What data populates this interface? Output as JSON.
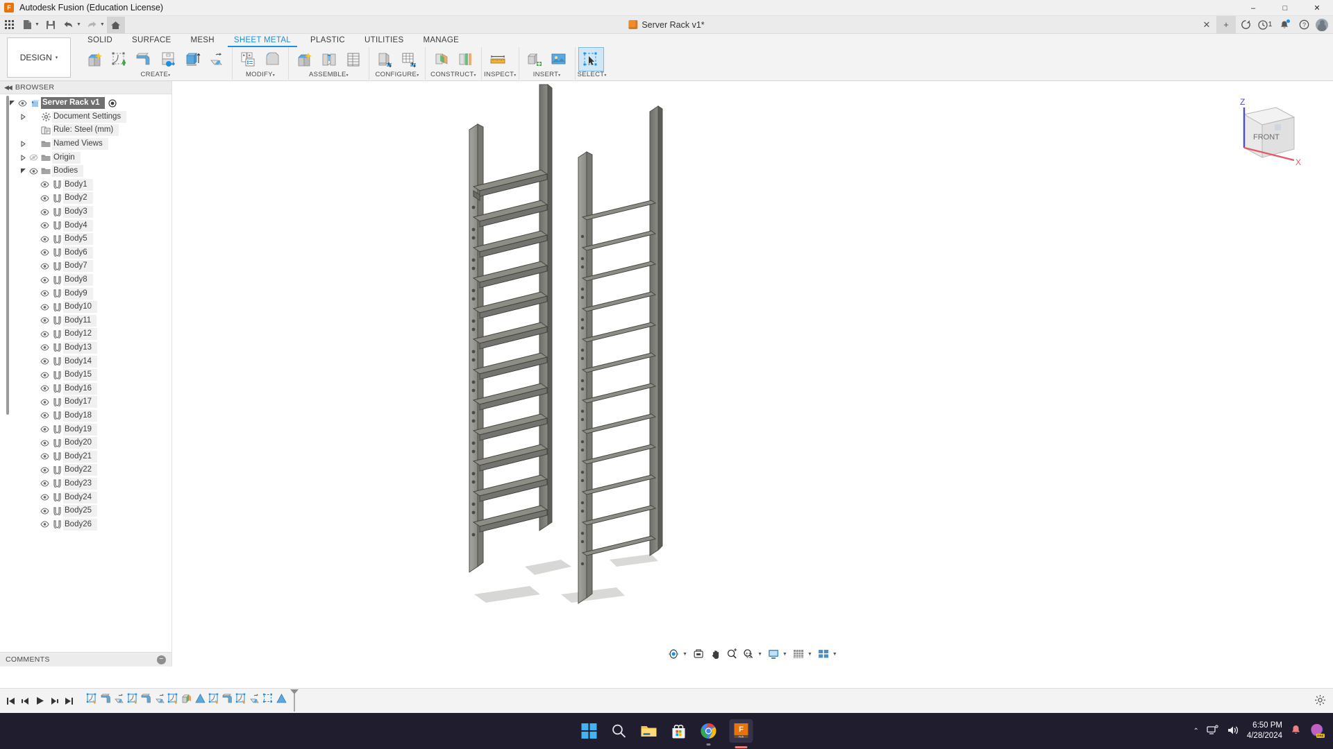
{
  "window": {
    "app_title": "Autodesk Fusion (Education License)",
    "app_icon": "fusion-logo-icon",
    "minimize": "–",
    "maximize": "□",
    "close": "✕"
  },
  "quick_access": {
    "grid_menu": "app-grid-icon",
    "new_file": "new-file-icon",
    "save": "save-icon",
    "undo": "undo-icon",
    "redo": "redo-icon",
    "home": "home-icon"
  },
  "document_tab": {
    "title": "Server Rack v1*",
    "icon": "orange-cube-icon",
    "close": "✕",
    "add_tab": "+"
  },
  "tab_right_icons": {
    "refresh": "refresh-icon",
    "jobs": "job-status-icon",
    "jobs_count": "1",
    "notifications": "bell-icon",
    "help": "help-icon",
    "account": "user-avatar-icon"
  },
  "workspace": {
    "label": "DESIGN",
    "caret": "▾"
  },
  "ribbon": {
    "tabs": [
      {
        "label": "SOLID",
        "active": false
      },
      {
        "label": "SURFACE",
        "active": false
      },
      {
        "label": "MESH",
        "active": false
      },
      {
        "label": "SHEET METAL",
        "active": true
      },
      {
        "label": "PLASTIC",
        "active": false
      },
      {
        "label": "UTILITIES",
        "active": false
      },
      {
        "label": "MANAGE",
        "active": false
      }
    ],
    "panels": [
      {
        "label": "CREATE",
        "caret": "▾",
        "tools": [
          "new-component-icon",
          "create-sketch-icon",
          "flange-icon",
          "contour-flange-icon",
          "extrude-icon",
          "unfold-icon"
        ]
      },
      {
        "label": "MODIFY",
        "caret": "▾",
        "tools": [
          "sheet-metal-rules-icon",
          "bend-icon"
        ]
      },
      {
        "label": "ASSEMBLE",
        "caret": "▾",
        "tools": [
          "new-component-assemble-icon",
          "joint-icon",
          "joint-origin-icon"
        ]
      },
      {
        "label": "CONFIGURE",
        "caret": "▾",
        "tools": [
          "configure-design-icon",
          "configuration-table-icon"
        ]
      },
      {
        "label": "CONSTRUCT",
        "caret": "▾",
        "tools": [
          "offset-plane-icon",
          "plane-at-angle-icon"
        ]
      },
      {
        "label": "INSPECT",
        "caret": "▾",
        "tools": [
          "measure-icon"
        ]
      },
      {
        "label": "INSERT",
        "caret": "▾",
        "tools": [
          "insert-derive-icon",
          "insert-canvas-icon"
        ]
      },
      {
        "label": "SELECT",
        "caret": "▾",
        "tools": [
          "select-cursor-icon"
        ]
      }
    ]
  },
  "browser": {
    "header": "BROWSER",
    "collapse_icon": "collapse-left-icon",
    "tree": [
      {
        "label": "Server Rack v1",
        "indent": 0,
        "arrow": "expanded",
        "eye": "visible",
        "icon": "component-icon",
        "selected": true,
        "trailing": "radio-icon"
      },
      {
        "label": "Document Settings",
        "indent": 1,
        "arrow": "collapsed",
        "eye": "none",
        "icon": "gear-icon",
        "selected": false
      },
      {
        "label": "Rule: Steel (mm)",
        "indent": 1,
        "arrow": "none",
        "eye": "none",
        "icon": "rule-icon",
        "selected": false
      },
      {
        "label": "Named Views",
        "indent": 1,
        "arrow": "collapsed",
        "eye": "none",
        "icon": "folder-icon",
        "selected": false
      },
      {
        "label": "Origin",
        "indent": 1,
        "arrow": "collapsed",
        "eye": "hidden",
        "icon": "folder-icon",
        "selected": false
      },
      {
        "label": "Bodies",
        "indent": 1,
        "arrow": "expanded",
        "eye": "visible",
        "icon": "folder-icon",
        "selected": false
      },
      {
        "label": "Body1",
        "indent": 2,
        "arrow": "none",
        "eye": "visible",
        "icon": "body-icon",
        "selected": false
      },
      {
        "label": "Body2",
        "indent": 2,
        "arrow": "none",
        "eye": "visible",
        "icon": "body-icon",
        "selected": false
      },
      {
        "label": "Body3",
        "indent": 2,
        "arrow": "none",
        "eye": "visible",
        "icon": "body-icon",
        "selected": false
      },
      {
        "label": "Body4",
        "indent": 2,
        "arrow": "none",
        "eye": "visible",
        "icon": "body-icon",
        "selected": false
      },
      {
        "label": "Body5",
        "indent": 2,
        "arrow": "none",
        "eye": "visible",
        "icon": "body-icon",
        "selected": false
      },
      {
        "label": "Body6",
        "indent": 2,
        "arrow": "none",
        "eye": "visible",
        "icon": "body-icon",
        "selected": false
      },
      {
        "label": "Body7",
        "indent": 2,
        "arrow": "none",
        "eye": "visible",
        "icon": "body-icon",
        "selected": false
      },
      {
        "label": "Body8",
        "indent": 2,
        "arrow": "none",
        "eye": "visible",
        "icon": "body-icon",
        "selected": false
      },
      {
        "label": "Body9",
        "indent": 2,
        "arrow": "none",
        "eye": "visible",
        "icon": "body-icon",
        "selected": false
      },
      {
        "label": "Body10",
        "indent": 2,
        "arrow": "none",
        "eye": "visible",
        "icon": "body-icon",
        "selected": false
      },
      {
        "label": "Body11",
        "indent": 2,
        "arrow": "none",
        "eye": "visible",
        "icon": "body-icon",
        "selected": false
      },
      {
        "label": "Body12",
        "indent": 2,
        "arrow": "none",
        "eye": "visible",
        "icon": "body-icon",
        "selected": false
      },
      {
        "label": "Body13",
        "indent": 2,
        "arrow": "none",
        "eye": "visible",
        "icon": "body-icon",
        "selected": false
      },
      {
        "label": "Body14",
        "indent": 2,
        "arrow": "none",
        "eye": "visible",
        "icon": "body-icon",
        "selected": false
      },
      {
        "label": "Body15",
        "indent": 2,
        "arrow": "none",
        "eye": "visible",
        "icon": "body-icon",
        "selected": false
      },
      {
        "label": "Body16",
        "indent": 2,
        "arrow": "none",
        "eye": "visible",
        "icon": "body-icon",
        "selected": false
      },
      {
        "label": "Body17",
        "indent": 2,
        "arrow": "none",
        "eye": "visible",
        "icon": "body-icon",
        "selected": false
      },
      {
        "label": "Body18",
        "indent": 2,
        "arrow": "none",
        "eye": "visible",
        "icon": "body-icon",
        "selected": false
      },
      {
        "label": "Body19",
        "indent": 2,
        "arrow": "none",
        "eye": "visible",
        "icon": "body-icon",
        "selected": false
      },
      {
        "label": "Body20",
        "indent": 2,
        "arrow": "none",
        "eye": "visible",
        "icon": "body-icon",
        "selected": false
      },
      {
        "label": "Body21",
        "indent": 2,
        "arrow": "none",
        "eye": "visible",
        "icon": "body-icon",
        "selected": false
      },
      {
        "label": "Body22",
        "indent": 2,
        "arrow": "none",
        "eye": "visible",
        "icon": "body-icon",
        "selected": false
      },
      {
        "label": "Body23",
        "indent": 2,
        "arrow": "none",
        "eye": "visible",
        "icon": "body-icon",
        "selected": false
      },
      {
        "label": "Body24",
        "indent": 2,
        "arrow": "none",
        "eye": "visible",
        "icon": "body-icon",
        "selected": false
      },
      {
        "label": "Body25",
        "indent": 2,
        "arrow": "none",
        "eye": "visible",
        "icon": "body-icon",
        "selected": false
      },
      {
        "label": "Body26",
        "indent": 2,
        "arrow": "none",
        "eye": "visible",
        "icon": "body-icon",
        "selected": false
      }
    ]
  },
  "comments": {
    "label": "COMMENTS",
    "add_icon": "add-comment-icon"
  },
  "viewcube": {
    "face": "FRONT",
    "axis_z": "Z",
    "axis_x": "X",
    "z_color": "#4a4ae0",
    "x_color": "#e05a6a"
  },
  "navbar": {
    "items": [
      {
        "name": "orbit-icon",
        "caret": "▾"
      },
      {
        "name": "look-at-icon",
        "caret": ""
      },
      {
        "name": "pan-icon",
        "caret": ""
      },
      {
        "name": "zoom-icon",
        "caret": ""
      },
      {
        "name": "zoom-window-icon",
        "caret": "▾"
      },
      {
        "name": "display-settings-icon",
        "caret": "▾"
      },
      {
        "name": "grid-snaps-icon",
        "caret": "▾"
      },
      {
        "name": "viewports-icon",
        "caret": "▾"
      }
    ]
  },
  "timeline": {
    "playback": [
      "go-to-beginning-icon",
      "step-back-icon",
      "play-icon",
      "step-forward-icon",
      "go-to-end-icon"
    ],
    "features": [
      "sketch-icon",
      "flange-icon",
      "unfold-icon",
      "sketch-icon",
      "flange-icon",
      "unfold-icon",
      "sketch-icon",
      "appearance-icon",
      "pattern-icon",
      "sketch-icon",
      "flange-icon",
      "sketch-icon",
      "unfold-icon",
      "select-icon",
      "pattern-icon"
    ],
    "marker": "timeline-end-marker",
    "settings_icon": "timeline-settings-icon"
  },
  "taskbar": {
    "icons": [
      {
        "name": "windows-start-icon",
        "active": false
      },
      {
        "name": "search-icon",
        "active": false
      },
      {
        "name": "file-explorer-icon",
        "active": false
      },
      {
        "name": "microsoft-store-icon",
        "active": false
      },
      {
        "name": "google-chrome-icon",
        "active": true
      },
      {
        "name": "autodesk-fusion-icon",
        "active": true
      }
    ],
    "tray": {
      "chevron": "⌃",
      "network_icon": "network-icon",
      "volume_icon": "volume-icon",
      "time": "6:50 PM",
      "date": "4/28/2024",
      "notification_icon": "bell-icon",
      "copilot_icon": "copilot-pre-icon"
    }
  },
  "model": {
    "name": "server-rack-3d-model",
    "description": "Two sheet-metal rack side frames with shelf rails"
  }
}
